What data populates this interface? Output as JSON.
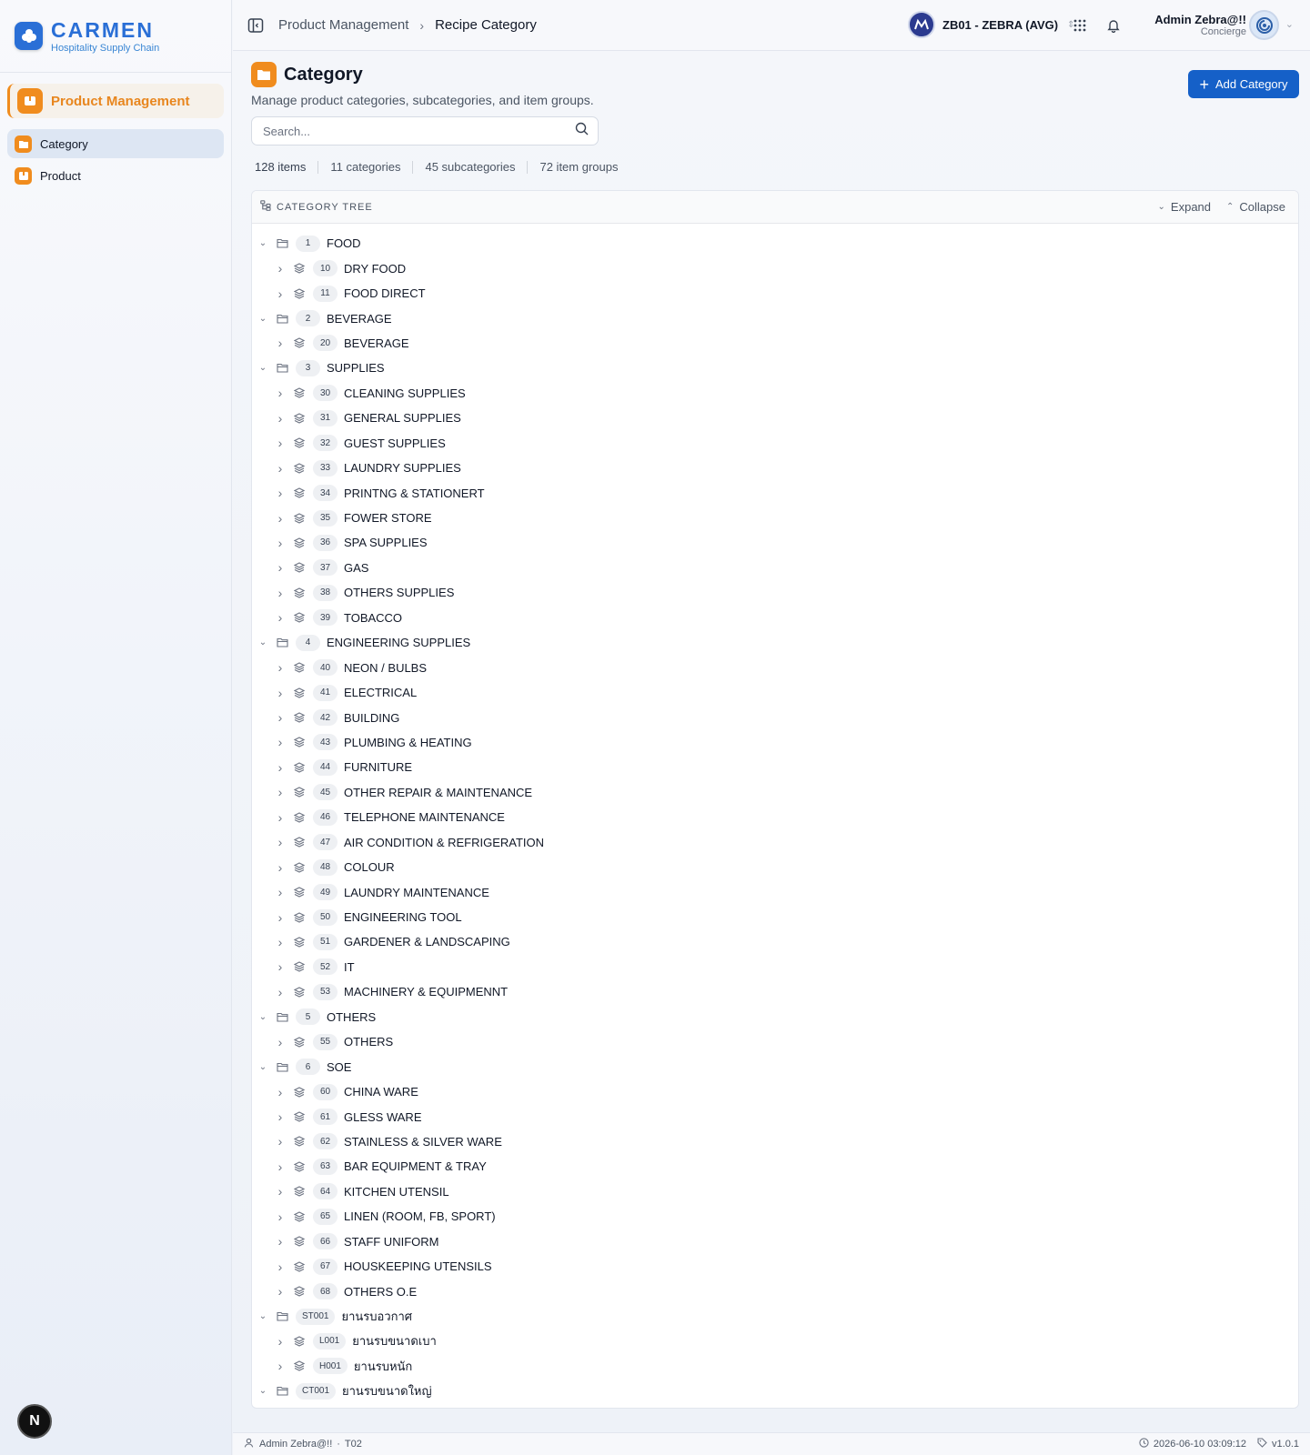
{
  "brand": {
    "title": "CARMEN",
    "subtitle": "Hospitality Supply Chain"
  },
  "sidebar": {
    "module": "Product Management",
    "items": [
      {
        "label": "Category",
        "active": true
      },
      {
        "label": "Product",
        "active": false
      }
    ]
  },
  "topbar": {
    "breadcrumb": [
      "Product Management",
      "Recipe Category"
    ],
    "business_unit": "ZB01 - ZEBRA (AVG)",
    "user_name": "Admin Zebra@!!",
    "user_role": "Concierge"
  },
  "page": {
    "title": "Category",
    "subtitle": "Manage product categories, subcategories, and item groups.",
    "add_button": "Add Category",
    "search_placeholder": "Search...",
    "stats": [
      "128 items",
      "11 categories",
      "45 subcategories",
      "72 item groups"
    ]
  },
  "tree_panel": {
    "header": "CATEGORY TREE",
    "expand_label": "Expand",
    "collapse_label": "Collapse",
    "rows": [
      {
        "level": 0,
        "code": "1",
        "name": "FOOD"
      },
      {
        "level": 1,
        "code": "10",
        "name": "DRY FOOD"
      },
      {
        "level": 1,
        "code": "11",
        "name": "FOOD DIRECT"
      },
      {
        "level": 0,
        "code": "2",
        "name": "BEVERAGE"
      },
      {
        "level": 1,
        "code": "20",
        "name": "BEVERAGE"
      },
      {
        "level": 0,
        "code": "3",
        "name": "SUPPLIES"
      },
      {
        "level": 1,
        "code": "30",
        "name": "CLEANING SUPPLIES"
      },
      {
        "level": 1,
        "code": "31",
        "name": "GENERAL SUPPLIES"
      },
      {
        "level": 1,
        "code": "32",
        "name": "GUEST SUPPLIES"
      },
      {
        "level": 1,
        "code": "33",
        "name": "LAUNDRY SUPPLIES"
      },
      {
        "level": 1,
        "code": "34",
        "name": "PRINTNG & STATIONERT"
      },
      {
        "level": 1,
        "code": "35",
        "name": "FOWER STORE"
      },
      {
        "level": 1,
        "code": "36",
        "name": "SPA SUPPLIES"
      },
      {
        "level": 1,
        "code": "37",
        "name": "GAS"
      },
      {
        "level": 1,
        "code": "38",
        "name": "OTHERS SUPPLIES"
      },
      {
        "level": 1,
        "code": "39",
        "name": "TOBACCO"
      },
      {
        "level": 0,
        "code": "4",
        "name": "ENGINEERING SUPPLIES"
      },
      {
        "level": 1,
        "code": "40",
        "name": "NEON / BULBS"
      },
      {
        "level": 1,
        "code": "41",
        "name": "ELECTRICAL"
      },
      {
        "level": 1,
        "code": "42",
        "name": "BUILDING"
      },
      {
        "level": 1,
        "code": "43",
        "name": "PLUMBING & HEATING"
      },
      {
        "level": 1,
        "code": "44",
        "name": "FURNITURE"
      },
      {
        "level": 1,
        "code": "45",
        "name": "OTHER REPAIR & MAINTENANCE"
      },
      {
        "level": 1,
        "code": "46",
        "name": "TELEPHONE MAINTENANCE"
      },
      {
        "level": 1,
        "code": "47",
        "name": "AIR CONDITION & REFRIGERATION"
      },
      {
        "level": 1,
        "code": "48",
        "name": "COLOUR"
      },
      {
        "level": 1,
        "code": "49",
        "name": "LAUNDRY MAINTENANCE"
      },
      {
        "level": 1,
        "code": "50",
        "name": "ENGINEERING TOOL"
      },
      {
        "level": 1,
        "code": "51",
        "name": "GARDENER & LANDSCAPING"
      },
      {
        "level": 1,
        "code": "52",
        "name": "IT"
      },
      {
        "level": 1,
        "code": "53",
        "name": "MACHINERY & EQUIPMENNT"
      },
      {
        "level": 0,
        "code": "5",
        "name": "OTHERS"
      },
      {
        "level": 1,
        "code": "55",
        "name": "OTHERS"
      },
      {
        "level": 0,
        "code": "6",
        "name": "SOE"
      },
      {
        "level": 1,
        "code": "60",
        "name": "CHINA WARE"
      },
      {
        "level": 1,
        "code": "61",
        "name": "GLESS WARE"
      },
      {
        "level": 1,
        "code": "62",
        "name": "STAINLESS & SILVER WARE"
      },
      {
        "level": 1,
        "code": "63",
        "name": "BAR EQUIPMENT & TRAY"
      },
      {
        "level": 1,
        "code": "64",
        "name": "KITCHEN UTENSIL"
      },
      {
        "level": 1,
        "code": "65",
        "name": "LINEN (ROOM, FB, SPORT)"
      },
      {
        "level": 1,
        "code": "66",
        "name": "STAFF UNIFORM"
      },
      {
        "level": 1,
        "code": "67",
        "name": "HOUSKEEPING UTENSILS"
      },
      {
        "level": 1,
        "code": "68",
        "name": "OTHERS O.E"
      },
      {
        "level": 0,
        "code": "ST001",
        "name": "ยานรบอวกาศ"
      },
      {
        "level": 1,
        "code": "L001",
        "name": "ยานรบขนาดเบา"
      },
      {
        "level": 1,
        "code": "H001",
        "name": "ยานรบหนัก"
      },
      {
        "level": 0,
        "code": "CT001",
        "name": "ยานรบขนาดใหญ่"
      }
    ]
  },
  "footer": {
    "user": "Admin Zebra@!!",
    "code": "T02",
    "timestamp": "2026-06-10 03:09:12",
    "version": "v1.0.1"
  },
  "colors": {
    "primary": "#1560c8",
    "accent": "#f08c1e",
    "brand": "#2a6fd6"
  }
}
